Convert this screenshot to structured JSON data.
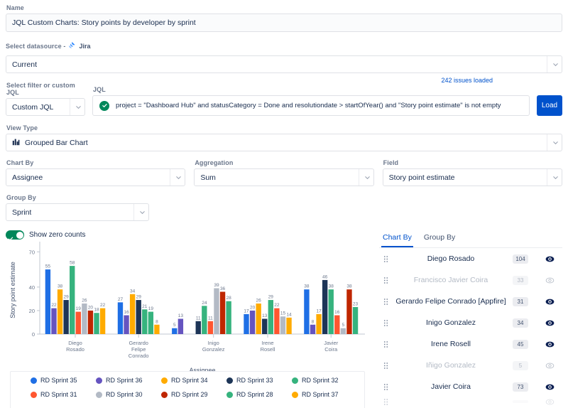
{
  "form": {
    "name_label": "Name",
    "name_value": "JQL Custom Charts: Story points by developer by sprint",
    "datasource_label": "Select datasource -",
    "datasource_brand": "Jira",
    "datasource_value": "Current",
    "filter_label": "Select filter or custom JQL",
    "filter_value": "Custom JQL",
    "jql_label": "JQL",
    "jql_value": "project = \"Dashboard Hub\" and statusCategory = Done and resolutiondate > startOfYear() and \"Story point estimate\" is not empty",
    "issues_loaded": "242 issues loaded",
    "load_button": "Load",
    "viewtype_label": "View Type",
    "viewtype_value": "Grouped Bar Chart",
    "chartby_label": "Chart By",
    "chartby_value": "Assignee",
    "aggregation_label": "Aggregation",
    "aggregation_value": "Sum",
    "field_label": "Field",
    "field_value": "Story point estimate",
    "groupby_label": "Group By",
    "groupby_value": "Sprint",
    "zero_counts_label": "Show zero counts",
    "zero_counts_on": true
  },
  "chart_data": {
    "type": "bar",
    "title": "",
    "xlabel": "Assignee",
    "ylabel": "Story point estimate",
    "ylim": [
      0,
      75
    ],
    "yticks": [
      0,
      20,
      40,
      70
    ],
    "grid": false,
    "legend_position": "bottom",
    "categories": [
      "Diego Rosado",
      "Gerardo Felipe Conrado",
      "Inigo Gonzalez",
      "Irene Rosell",
      "Javier Coira"
    ],
    "series": [
      {
        "name": "RD Sprint 35",
        "color": "#1f6fe5",
        "values": [
          55,
          27,
          0,
          17,
          38
        ]
      },
      {
        "name": "RD Sprint 36",
        "color": "#6554c0",
        "values": [
          22,
          16,
          0,
          20,
          8
        ]
      },
      {
        "name": "RD Sprint 34",
        "color": "#ffab00",
        "values": [
          38,
          34,
          0,
          26,
          17
        ]
      },
      {
        "name": "RD Sprint 33",
        "color": "#1d3557",
        "values": [
          29,
          29,
          11,
          13,
          46
        ]
      },
      {
        "name": "RD Sprint 32",
        "color": "#36b37e",
        "values": [
          58,
          21,
          24,
          29,
          38
        ]
      },
      {
        "name": "RD Sprint 31",
        "color": "#ff5630",
        "values": [
          19,
          0,
          11,
          22,
          16
        ]
      },
      {
        "name": "RD Sprint 30",
        "color": "#b3bac5",
        "values": [
          26,
          0,
          39,
          15,
          5
        ]
      },
      {
        "name": "RD Sprint 29",
        "color": "#bf2600",
        "values": [
          20,
          0,
          36,
          0,
          38
        ]
      },
      {
        "name": "RD Sprint 28",
        "color": "#36b37e",
        "values": [
          18,
          19,
          28,
          0,
          23
        ]
      },
      {
        "name": "RD Sprint 37",
        "color": "#ffab00",
        "values": [
          22,
          8,
          0,
          14,
          0
        ]
      }
    ],
    "extra_group": {
      "label": "",
      "bars": [
        {
          "name": "RD Sprint 35",
          "color": "#1f6fe5",
          "value": 5
        },
        {
          "name": "RD Sprint 36",
          "color": "#6554c0",
          "value": 13
        }
      ]
    }
  },
  "panel": {
    "tabs": [
      {
        "label": "Chart By",
        "active": true
      },
      {
        "label": "Group By",
        "active": false
      }
    ],
    "rows": [
      {
        "name": "Diego Rosado",
        "count": "104",
        "visible": true
      },
      {
        "name": "Francisco Javier Coira",
        "count": "33",
        "visible": false
      },
      {
        "name": "Gerardo Felipe Conrado [Appfire]",
        "count": "31",
        "visible": true
      },
      {
        "name": "Inigo Gonzalez",
        "count": "34",
        "visible": true
      },
      {
        "name": "Irene Rosell",
        "count": "45",
        "visible": true
      },
      {
        "name": "Iñigo Gonzalez",
        "count": "5",
        "visible": false
      },
      {
        "name": "Javier Coira",
        "count": "73",
        "visible": true
      }
    ]
  }
}
